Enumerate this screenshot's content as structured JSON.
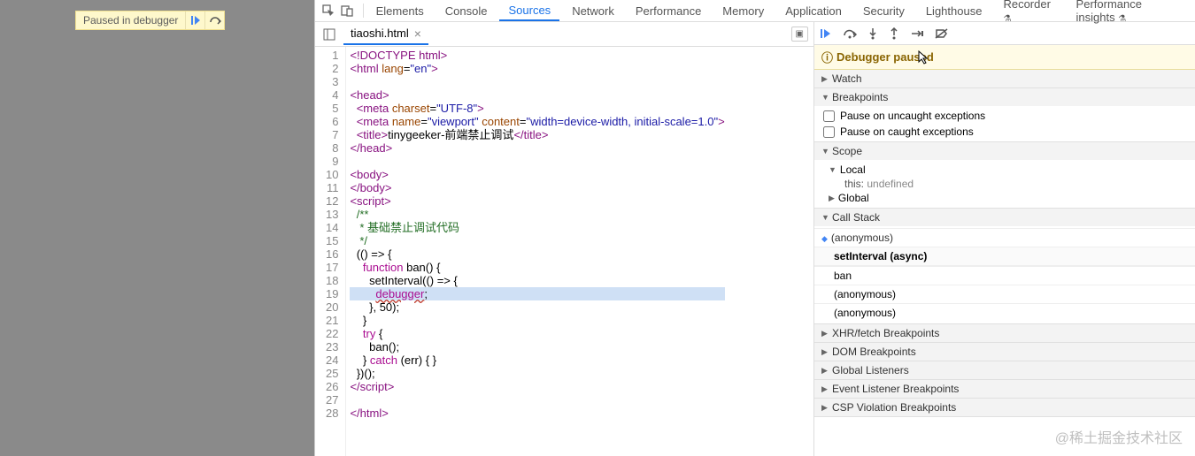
{
  "pausedBadge": {
    "text": "Paused in debugger"
  },
  "devtoolsTabs": {
    "elements": "Elements",
    "console": "Console",
    "sources": "Sources",
    "network": "Network",
    "performance": "Performance",
    "memory": "Memory",
    "application": "Application",
    "security": "Security",
    "lighthouse": "Lighthouse",
    "recorder": "Recorder",
    "perfInsights": "Performance insights"
  },
  "fileTab": {
    "name": "tiaoshi.html"
  },
  "editor": {
    "lines": [
      {
        "n": 1,
        "html": "<span class='tok-tag'>&lt;!DOCTYPE html&gt;</span>"
      },
      {
        "n": 2,
        "html": "<span class='tok-tag'>&lt;html</span> <span class='tok-attr'>lang</span>=<span class='tok-str'>\"en\"</span><span class='tok-tag'>&gt;</span>"
      },
      {
        "n": 3,
        "html": ""
      },
      {
        "n": 4,
        "html": "<span class='tok-tag'>&lt;head&gt;</span>"
      },
      {
        "n": 5,
        "html": "  <span class='tok-tag'>&lt;meta</span> <span class='tok-attr'>charset</span>=<span class='tok-str'>\"UTF-8\"</span><span class='tok-tag'>&gt;</span>"
      },
      {
        "n": 6,
        "html": "  <span class='tok-tag'>&lt;meta</span> <span class='tok-attr'>name</span>=<span class='tok-str'>\"viewport\"</span> <span class='tok-attr'>content</span>=<span class='tok-str'>\"width=device-width, initial-scale=1.0\"</span><span class='tok-tag'>&gt;</span>"
      },
      {
        "n": 7,
        "html": "  <span class='tok-tag'>&lt;title&gt;</span>tinygeeker-前端禁止调试<span class='tok-tag'>&lt;/title&gt;</span>"
      },
      {
        "n": 8,
        "html": "<span class='tok-tag'>&lt;/head&gt;</span>"
      },
      {
        "n": 9,
        "html": ""
      },
      {
        "n": 10,
        "html": "<span class='tok-tag'>&lt;body&gt;</span>"
      },
      {
        "n": 11,
        "html": "<span class='tok-tag'>&lt;/body&gt;</span>"
      },
      {
        "n": 12,
        "html": "<span class='tok-tag'>&lt;script&gt;</span>"
      },
      {
        "n": 13,
        "html": "  <span class='tok-cmt'>/**</span>"
      },
      {
        "n": 14,
        "html": "  <span class='tok-cmt'> * 基础禁止调试代码</span>"
      },
      {
        "n": 15,
        "html": "  <span class='tok-cmt'> */</span>"
      },
      {
        "n": 16,
        "html": "  (() =&gt; {"
      },
      {
        "n": 17,
        "html": "    <span class='tok-kw'>function</span> <span class='tok-fn'>ban</span>() {"
      },
      {
        "n": 18,
        "html": "      setInterval(() =&gt; {"
      },
      {
        "n": 19,
        "hl": true,
        "html": "        <span class='tok-kw tok-dbg'>debugger</span>;"
      },
      {
        "n": 20,
        "html": "      }, 50);"
      },
      {
        "n": 21,
        "html": "    }"
      },
      {
        "n": 22,
        "html": "    <span class='tok-kw'>try</span> {"
      },
      {
        "n": 23,
        "html": "      ban();"
      },
      {
        "n": 24,
        "html": "    } <span class='tok-kw'>catch</span> (err) { }"
      },
      {
        "n": 25,
        "html": "  })();"
      },
      {
        "n": 26,
        "html": "<span class='tok-tag'>&lt;/script&gt;</span>"
      },
      {
        "n": 27,
        "html": ""
      },
      {
        "n": 28,
        "html": "<span class='tok-tag'>&lt;/html&gt;</span>"
      }
    ]
  },
  "debugger": {
    "pausedMsg": "Debugger paused",
    "sections": {
      "watch": "Watch",
      "breakpoints": "Breakpoints",
      "pauseUncaught": "Pause on uncaught exceptions",
      "pauseCaught": "Pause on caught exceptions",
      "scope": "Scope",
      "local": "Local",
      "thisLabel": "this:",
      "thisValue": "undefined",
      "global": "Global",
      "callstack": "Call Stack",
      "stack": {
        "top": "(anonymous)",
        "async": "setInterval (async)",
        "f1": "ban",
        "f2": "(anonymous)",
        "f3": "(anonymous)"
      },
      "xhr": "XHR/fetch Breakpoints",
      "dom": "DOM Breakpoints",
      "globalListeners": "Global Listeners",
      "eventListener": "Event Listener Breakpoints",
      "csp": "CSP Violation Breakpoints"
    }
  },
  "watermark": "@稀土掘金技术社区"
}
